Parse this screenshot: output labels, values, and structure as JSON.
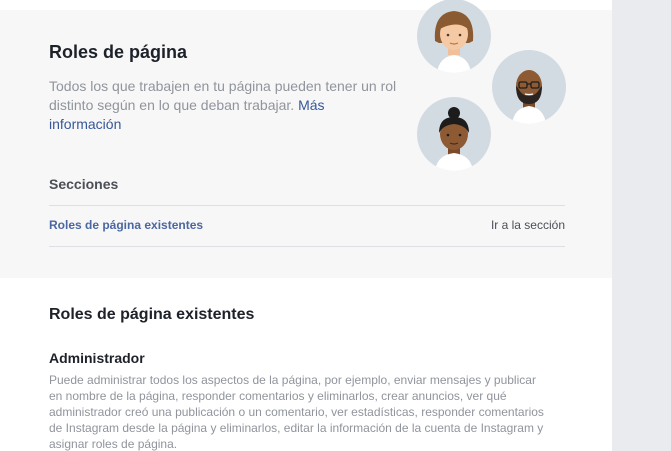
{
  "intro": {
    "title": "Roles de página",
    "description": "Todos los que trabajen en tu página pueden tener un rol distinto según en lo que deban trabajar.",
    "more_link": "Más información"
  },
  "sections": {
    "label": "Secciones",
    "items": [
      {
        "label": "Roles de página existentes",
        "action": "Ir a la sección"
      }
    ]
  },
  "existing_roles": {
    "title": "Roles de página existentes",
    "roles": [
      {
        "name": "Administrador",
        "description": "Puede administrar todos los aspectos de la página, por ejemplo, enviar mensajes y publicar en nombre de la página, responder comentarios y eliminarlos, crear anuncios, ver qué administrador creó una publicación o un comentario, ver estadísticas, responder comentarios de Instagram desde la página y eliminarlos, editar la información de la cuenta de Instagram y asignar roles de página."
      }
    ]
  },
  "illustration": {
    "icons": [
      "person-woman-icon",
      "person-bearded-man-icon",
      "person-woman-bun-icon"
    ],
    "circle_color": "#d3dbe2"
  }
}
